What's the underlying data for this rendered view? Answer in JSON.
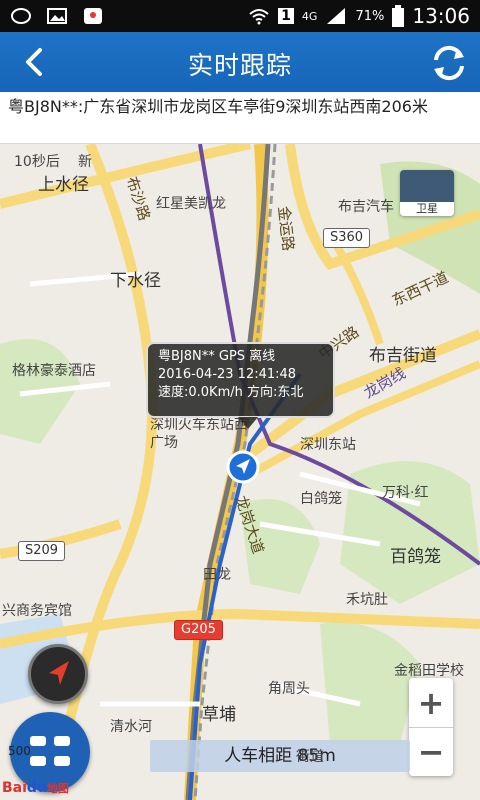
{
  "status_bar": {
    "network": "4G",
    "sim_slot": "1",
    "battery": "71%",
    "time": "13:06"
  },
  "header": {
    "title": "实时跟踪",
    "back_icon": "chevron-left-icon",
    "refresh_icon": "refresh-icon"
  },
  "address": {
    "text": "粤BJ8N**:广东省深圳市龙岗区车亭街9深圳东站西南206米"
  },
  "map": {
    "places": {
      "shangshuijing": "上水径",
      "hongxing": "红星美凯龙",
      "bujiqiche": "布吉汽车",
      "xiashuijing": "下水径",
      "gelinhaotai": "格林豪泰酒店",
      "bujijiedao": "布吉街道",
      "shenzhen_zhan_xi": "深圳火车东站西广场",
      "shenzhendongzhan": "深圳东站",
      "baigelong": "白鸽笼",
      "wankehong": "万科·红",
      "baigelong2": "百鸽笼",
      "heekengtun": "禾坑肚",
      "jindaotian": "金稻田学校",
      "xingshang": "兴商务宾馆",
      "caopu": "草埔",
      "jiaozhoutou": "角周头",
      "qingshuihe": "清水河",
      "tianlong": "田龙",
      "shiqiu_hou": "10秒后",
      "xin": "新",
      "jiedao_bottom": "街道"
    },
    "roads": {
      "buxi": "布沙路",
      "jinyun": "金运路",
      "dongxi": "东西干道",
      "zhongxing": "中兴路",
      "longgang": "龙岗线",
      "longgang_dadao": "龙岗大道"
    },
    "shields": {
      "s360": "S360",
      "s209": "S209",
      "g205": "G205"
    },
    "popup": {
      "line1": "粤BJ8N** GPS 离线",
      "line2": "2016-04-23 12:41:48",
      "line3": "速度:0.0Km/h 方向:东北"
    },
    "satellite_label": "卫星",
    "zoom_in": "+",
    "zoom_out": "−",
    "distance": "人车相距 85m",
    "scale": "500",
    "logo_bai": "Bai",
    "logo_du": "du",
    "logo_map": "地图"
  }
}
